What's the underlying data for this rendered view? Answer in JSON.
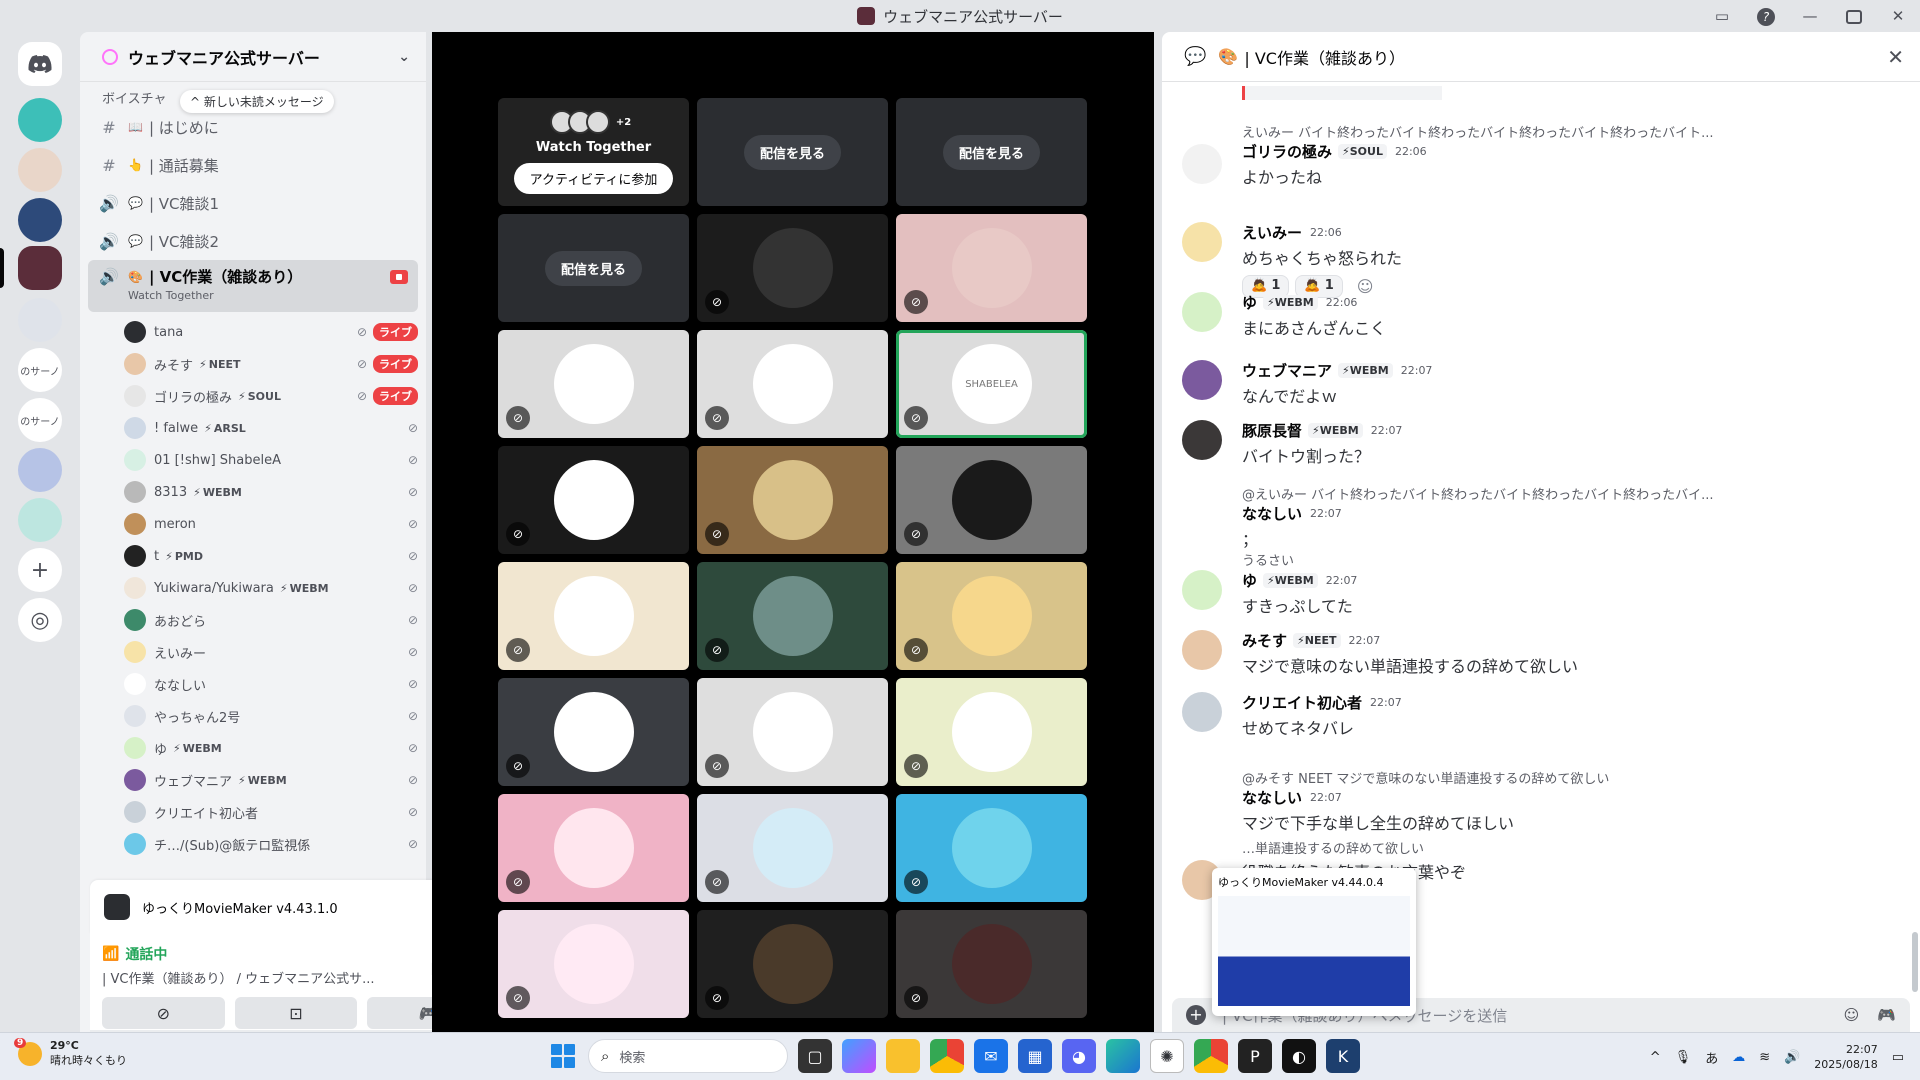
{
  "window": {
    "title": "ウェブマニア公式サーバー"
  },
  "server": {
    "name": "ウェブマニア公式サーバー",
    "category": "ボイスチャ",
    "new_messages": "新しい未読メッセージ"
  },
  "channels": [
    {
      "icon": "#",
      "emoji": "📖",
      "name": "| はじめに"
    },
    {
      "icon": "#",
      "emoji": "👆",
      "name": "| 通話募集"
    },
    {
      "icon": "🔊",
      "emoji": "💬",
      "name": "| VC雑談1"
    },
    {
      "icon": "🔊",
      "emoji": "💬",
      "name": "| VC雑談2"
    }
  ],
  "active_channel": {
    "name": "| VC作業（雑談あり）",
    "sub": "Watch Together"
  },
  "voice_users": [
    {
      "name": "tana",
      "tag": "",
      "live": "ライブ"
    },
    {
      "name": "みそす",
      "tag": "NEET",
      "live": "ライブ"
    },
    {
      "name": "ゴリラの極み",
      "tag": "SOUL",
      "live": "ライブ"
    },
    {
      "name": "! falwe",
      "tag": "ARSL",
      "live": ""
    },
    {
      "name": "01 [!shw] ShabeleA",
      "tag": "",
      "live": ""
    },
    {
      "name": "8313",
      "tag": "WEBM",
      "live": ""
    },
    {
      "name": "meron",
      "tag": "",
      "live": ""
    },
    {
      "name": "t",
      "tag": "PMD",
      "live": ""
    },
    {
      "name": "Yukiwara/Yukiwara",
      "tag": "WEBM",
      "live": ""
    },
    {
      "name": "あおどら",
      "tag": "",
      "live": ""
    },
    {
      "name": "えいみー",
      "tag": "",
      "live": ""
    },
    {
      "name": "ななしい",
      "tag": "",
      "live": ""
    },
    {
      "name": "やっちゃん2号",
      "tag": "",
      "live": ""
    },
    {
      "name": "ゆ",
      "tag": "WEBM",
      "live": ""
    },
    {
      "name": "ウェブマニア",
      "tag": "WEBM",
      "live": ""
    },
    {
      "name": "クリエイト初心者",
      "tag": "",
      "live": ""
    },
    {
      "name": "チ…/(Sub)@飯テロ監視係",
      "tag": "",
      "live": ""
    }
  ],
  "activity": {
    "name": "ゆっくりMovieMaker v4.43.1.0"
  },
  "voice": {
    "status": "通話中",
    "location": "| VC作業（雑談あり） / ウェブマニア公式サ..."
  },
  "user": {
    "name": "ゆ"
  },
  "stage": {
    "watch_together": {
      "title": "Watch Together",
      "count": "+2",
      "join": "アクティビティに参加"
    },
    "watch_stream": "配信を見る",
    "speaker_label": "SHABELEA",
    "tiles": [
      "tile-watch",
      "stream",
      "stream",
      "stream",
      "avatar",
      "avatar",
      "avatar",
      "avatar",
      "avatar-speaking",
      "avatar",
      "avatar",
      "avatar",
      "avatar",
      "avatar",
      "avatar",
      "avatar",
      "avatar",
      "avatar",
      "avatar",
      "avatar",
      "avatar",
      "avatar",
      "avatar",
      "avatar"
    ]
  },
  "chat": {
    "title": "| VC作業（雑談あり）",
    "messages": [
      {
        "reply": "えいみー バイト終わったバイト終わったバイト終わったバイト終わったバイト...",
        "name": "ゴリラの極み",
        "tag": "SOUL",
        "time": "22:06",
        "text": "よかったね"
      },
      {
        "reply": "",
        "name": "えいみー",
        "tag": "",
        "time": "22:06",
        "text": "めちゃくちゃ怒られた",
        "reactions": [
          "1",
          "1"
        ]
      },
      {
        "reply": "",
        "name": "ゆ",
        "tag": "WEBM",
        "time": "22:06",
        "text": "まにあさんざんこく"
      },
      {
        "reply": "",
        "name": "ウェブマニア",
        "tag": "WEBM",
        "time": "22:07",
        "text": "なんでだよｗ"
      },
      {
        "reply": "",
        "name": "豚原長督",
        "tag": "WEBM",
        "time": "22:07",
        "text": "バイトウ割った？"
      },
      {
        "reply": "@えいみー バイト終わったバイト終わったバイト終わったバイト終わったバイ...",
        "name": "ななしい",
        "tag": "",
        "time": "22:07",
        "text": "；",
        "extra": "うるさい"
      },
      {
        "reply": "",
        "name": "ゆ",
        "tag": "WEBM",
        "time": "22:07",
        "text": "すきっぷしてた"
      },
      {
        "reply": "",
        "name": "みそす",
        "tag": "NEET",
        "time": "22:07",
        "text": "マジで意味のない単語連投するの辞めて欲しい"
      },
      {
        "reply": "",
        "name": "クリエイト初心者",
        "tag": "",
        "time": "22:07",
        "text": "せめてネタバレ"
      },
      {
        "reply": "@みそす NEET マジで意味のない単語連投するの辞めて欲しい",
        "name": "ななしい",
        "tag": "",
        "time": "22:07",
        "text": "マジで下手な単し全生の辞めてほしい"
      },
      {
        "reply": "…単語連投するの辞めて欲しい",
        "name": "",
        "tag": "",
        "time": "",
        "text": "役職を終えた歓喜のお言葉やぞ"
      }
    ],
    "input_placeholder": "| VC作業（雑談あり）へメッセージを送信",
    "preview_title": "ゆっくりMovieMaker v4.44.0.4"
  },
  "taskbar": {
    "temp": "29°C",
    "weather": "晴れ時々くもり",
    "badge": "9",
    "search": "検索",
    "time": "22:07",
    "date": "2025/08/18"
  },
  "guild_labels": [
    "のサーノ",
    "のサーノ"
  ],
  "colors": {
    "live": "#ed4245",
    "online": "#23a55a",
    "accent": "#5865f2"
  }
}
